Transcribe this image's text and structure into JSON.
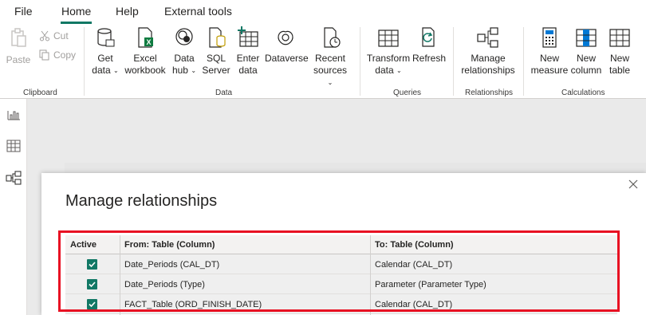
{
  "menu": {
    "file": "File",
    "home": "Home",
    "help": "Help",
    "external_tools": "External tools"
  },
  "ribbon": {
    "clipboard": {
      "paste": "Paste",
      "cut": "Cut",
      "copy": "Copy",
      "label": "Clipboard"
    },
    "data": {
      "get_data_1": "Get",
      "get_data_2": "data",
      "excel_1": "Excel",
      "excel_2": "workbook",
      "datahub_1": "Data",
      "datahub_2": "hub",
      "sql_1": "SQL",
      "sql_2": "Server",
      "enter_1": "Enter",
      "enter_2": "data",
      "dataverse": "Dataverse",
      "recent_1": "Recent",
      "recent_2": "sources",
      "label": "Data"
    },
    "queries": {
      "transform_1": "Transform",
      "transform_2": "data",
      "refresh": "Refresh",
      "label": "Queries"
    },
    "relationships": {
      "manage_1": "Manage",
      "manage_2": "relationships",
      "label": "Relationships"
    },
    "calculations": {
      "measure_1": "New",
      "measure_2": "measure",
      "column_1": "New",
      "column_2": "column",
      "table_1": "New",
      "table_2": "table",
      "label": "Calculations"
    }
  },
  "dialog": {
    "title": "Manage relationships",
    "columns": {
      "active": "Active",
      "from": "From: Table (Column)",
      "to": "To: Table (Column)"
    },
    "rows": [
      {
        "active": true,
        "from": "Date_Periods (CAL_DT)",
        "to": "Calendar (CAL_DT)"
      },
      {
        "active": true,
        "from": "Date_Periods (Type)",
        "to": "Parameter (Parameter Type)"
      },
      {
        "active": true,
        "from": "FACT_Table (ORD_FINISH_DATE)",
        "to": "Calendar (CAL_DT)"
      }
    ]
  },
  "colors": {
    "accent": "#117865",
    "highlight": "#e81123"
  }
}
